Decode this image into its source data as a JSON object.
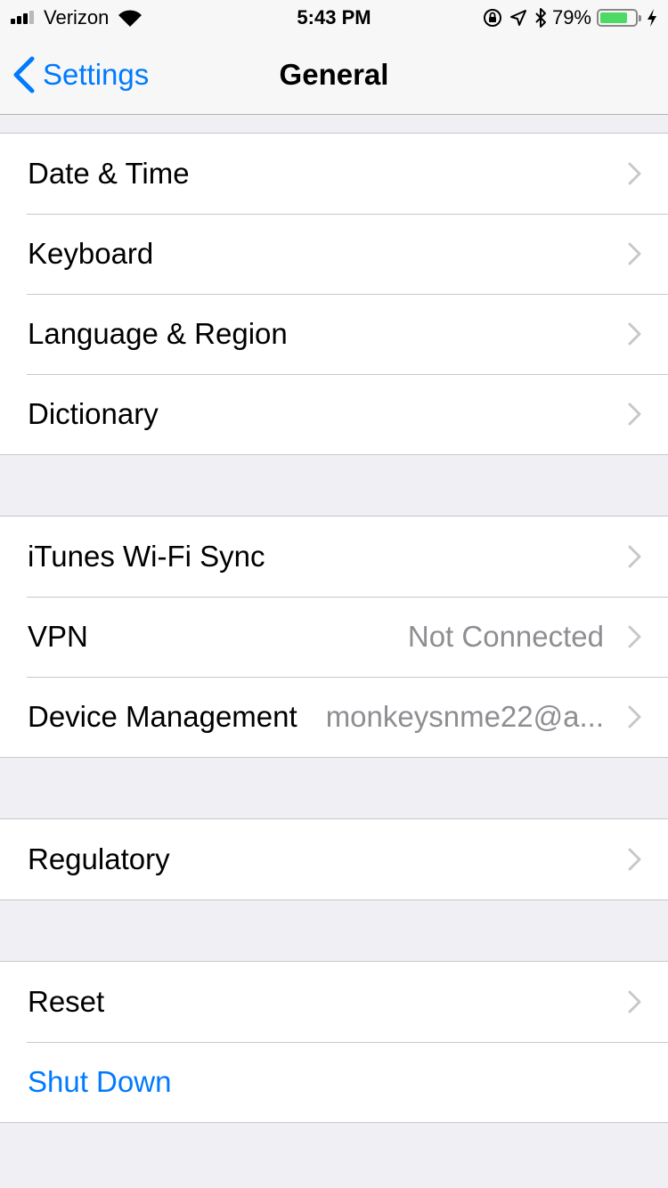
{
  "status_bar": {
    "carrier": "Verizon",
    "time": "5:43 PM",
    "battery_percent": "79%",
    "battery_level": 0.79,
    "battery_color": "#4cd964",
    "icons": [
      "signal-icon",
      "wifi-icon",
      "orientation-lock-icon",
      "location-icon",
      "bluetooth-icon",
      "battery-icon",
      "charging-icon"
    ]
  },
  "nav": {
    "back_label": "Settings",
    "title": "General",
    "accent": "#007aff"
  },
  "groups": [
    {
      "items": [
        {
          "label": "Date & Time",
          "value": ""
        },
        {
          "label": "Keyboard",
          "value": ""
        },
        {
          "label": "Language & Region",
          "value": ""
        },
        {
          "label": "Dictionary",
          "value": ""
        }
      ]
    },
    {
      "items": [
        {
          "label": "iTunes Wi-Fi Sync",
          "value": ""
        },
        {
          "label": "VPN",
          "value": "Not Connected"
        },
        {
          "label": "Device Management",
          "value": "monkeysnme22@a..."
        }
      ]
    },
    {
      "items": [
        {
          "label": "Regulatory",
          "value": ""
        }
      ]
    },
    {
      "items": [
        {
          "label": "Reset",
          "value": ""
        },
        {
          "label": "Shut Down",
          "value": ""
        }
      ]
    }
  ]
}
